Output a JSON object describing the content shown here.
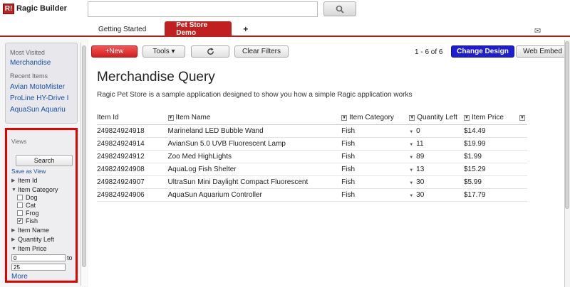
{
  "header": {
    "logo_mark": "R!",
    "logo_text": "Ragic Builder",
    "search_value": "",
    "tabs": [
      {
        "label": "Getting Started"
      },
      {
        "label": "Pet Store Demo"
      },
      {
        "label": "+"
      }
    ],
    "mail_icon": "envelope-icon"
  },
  "sidebar": {
    "most_visited_title": "Most Visited",
    "most_visited_link": "Merchandise",
    "recent_title": "Recent Items",
    "recent_items": [
      "Avian MotoMister",
      "ProLine HY-Drive I",
      "AquaSun Aquariu"
    ],
    "views": {
      "title": "Views",
      "search_label": "Search",
      "save_label": "Save as View",
      "fields": {
        "item_id": "Item Id",
        "item_category": "Item Category",
        "item_name": "Item Name",
        "quantity_left": "Quantity Left",
        "item_price": "Item Price"
      },
      "category_options": [
        {
          "label": "Dog",
          "checked": false
        },
        {
          "label": "Cat",
          "checked": false
        },
        {
          "label": "Frog",
          "checked": false
        },
        {
          "label": "Fish",
          "checked": true
        }
      ],
      "price_from": "0",
      "price_to": "25",
      "to_label": "to",
      "more_label": "More"
    }
  },
  "toolbar": {
    "new_label": "+New",
    "tools_label": "Tools ▾",
    "refresh_icon": "refresh-icon",
    "clear_label": "Clear Filters",
    "pager_text": "1 - 6 of 6",
    "change_design_label": "Change Design",
    "web_embed_label": "Web Embed"
  },
  "main": {
    "title": "Merchandise Query",
    "description": "Ragic Pet Store is a sample application designed to show you how a simple Ragic application works",
    "columns": [
      "Item Id",
      "Item Name",
      "Item Category",
      "Quantity Left",
      "Item Price"
    ],
    "rows": [
      {
        "id": "249824924918",
        "name": "Marineland LED Bubble Wand",
        "category": "Fish",
        "qty": "0",
        "price": "$14.49"
      },
      {
        "id": "249824924914",
        "name": "AvianSun 5.0 UVB Fluorescent Lamp",
        "category": "Fish",
        "qty": "11",
        "price": "$19.99"
      },
      {
        "id": "249824924912",
        "name": "Zoo Med HighLights",
        "category": "Fish",
        "qty": "89",
        "price": "$1.99"
      },
      {
        "id": "249824924908",
        "name": "AquaLog Fish Shelter",
        "category": "Fish",
        "qty": "13",
        "price": "$15.29"
      },
      {
        "id": "249824924907",
        "name": "UltraSun Mini Daylight Compact Fluorescent",
        "category": "Fish",
        "qty": "30",
        "price": "$5.99"
      },
      {
        "id": "249824924906",
        "name": "AquaSun Aquarium Controller",
        "category": "Fish",
        "qty": "30",
        "price": "$17.79"
      }
    ]
  },
  "colors": {
    "brand_red": "#c0201f",
    "highlight_red": "#e60000",
    "design_blue": "#1d1dd6",
    "link_blue": "#1a4fa0"
  }
}
